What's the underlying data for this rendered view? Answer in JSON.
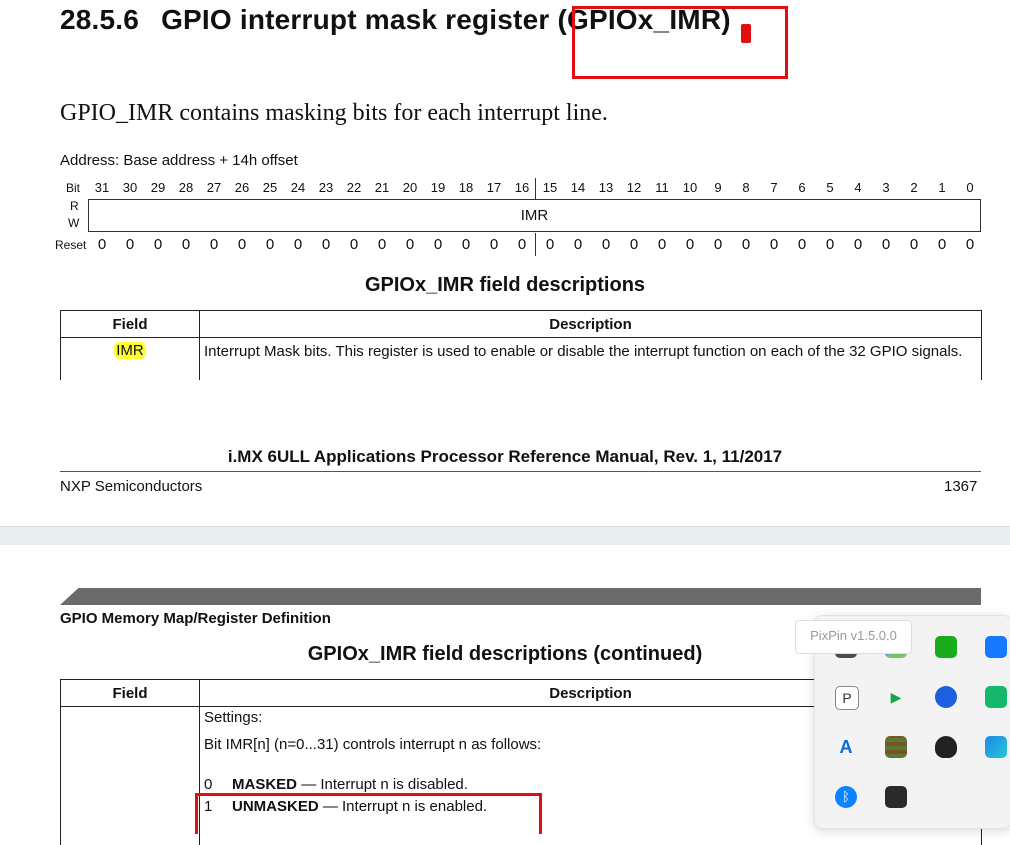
{
  "page1": {
    "section_number": "28.5.6",
    "section_title": "GPIO interrupt mask register",
    "section_reg": "(GPIOx_IMR)",
    "intro": "GPIO_IMR contains masking bits for each interrupt line.",
    "address": "Address: Base address + 14h offset",
    "bit_label": "Bit",
    "bits": [
      "31",
      "30",
      "29",
      "28",
      "27",
      "26",
      "25",
      "24",
      "23",
      "22",
      "21",
      "20",
      "19",
      "18",
      "17",
      "16",
      "15",
      "14",
      "13",
      "12",
      "11",
      "10",
      "9",
      "8",
      "7",
      "6",
      "5",
      "4",
      "3",
      "2",
      "1",
      "0"
    ],
    "rw_r": "R",
    "rw_w": "W",
    "register_field": "IMR",
    "reset_label": "Reset",
    "reset_values": [
      "0",
      "0",
      "0",
      "0",
      "0",
      "0",
      "0",
      "0",
      "0",
      "0",
      "0",
      "0",
      "0",
      "0",
      "0",
      "0",
      "0",
      "0",
      "0",
      "0",
      "0",
      "0",
      "0",
      "0",
      "0",
      "0",
      "0",
      "0",
      "0",
      "0",
      "0",
      "0"
    ],
    "table_title": "GPIOx_IMR field descriptions",
    "col_field": "Field",
    "col_desc": "Description",
    "row_field": "IMR",
    "row_desc": "Interrupt Mask bits. This register is used to enable or disable the interrupt function on each of the 32 GPIO signals.",
    "footer_title": "i.MX 6ULL Applications Processor Reference Manual, Rev. 1, 11/2017",
    "footer_left": "NXP Semiconductors",
    "footer_page": "1367"
  },
  "page2": {
    "section_header": "GPIO Memory Map/Register Definition",
    "table_title": "GPIOx_IMR field descriptions (continued)",
    "col_field": "Field",
    "col_desc": "Description",
    "settings": "Settings:",
    "bit_desc": "Bit IMR[n] (n=0...31) controls interrupt n as follows:",
    "opt0_num": "0",
    "opt0_name": "MASKED",
    "opt0_text": "— Interrupt n is disabled.",
    "opt1_num": "1",
    "opt1_name": "UNMASKED",
    "opt1_text": "— Interrupt n is enabled."
  },
  "tray": {
    "tooltip": "PixPin v1.5.0.0",
    "icons": [
      "nvidia-icon",
      "app-grid-icon",
      "wechat-icon",
      "feishu-icon",
      "pixpin-icon",
      "play-icon",
      "lens-icon",
      "chat-icon",
      "autodesk-icon",
      "minecraft-icon",
      "qq-icon",
      "tencent-meeting-icon",
      "bluetooth-icon",
      "cube-icon"
    ]
  },
  "colors": {
    "highlight": "#ffff33",
    "annotation_red": "#e01010"
  }
}
